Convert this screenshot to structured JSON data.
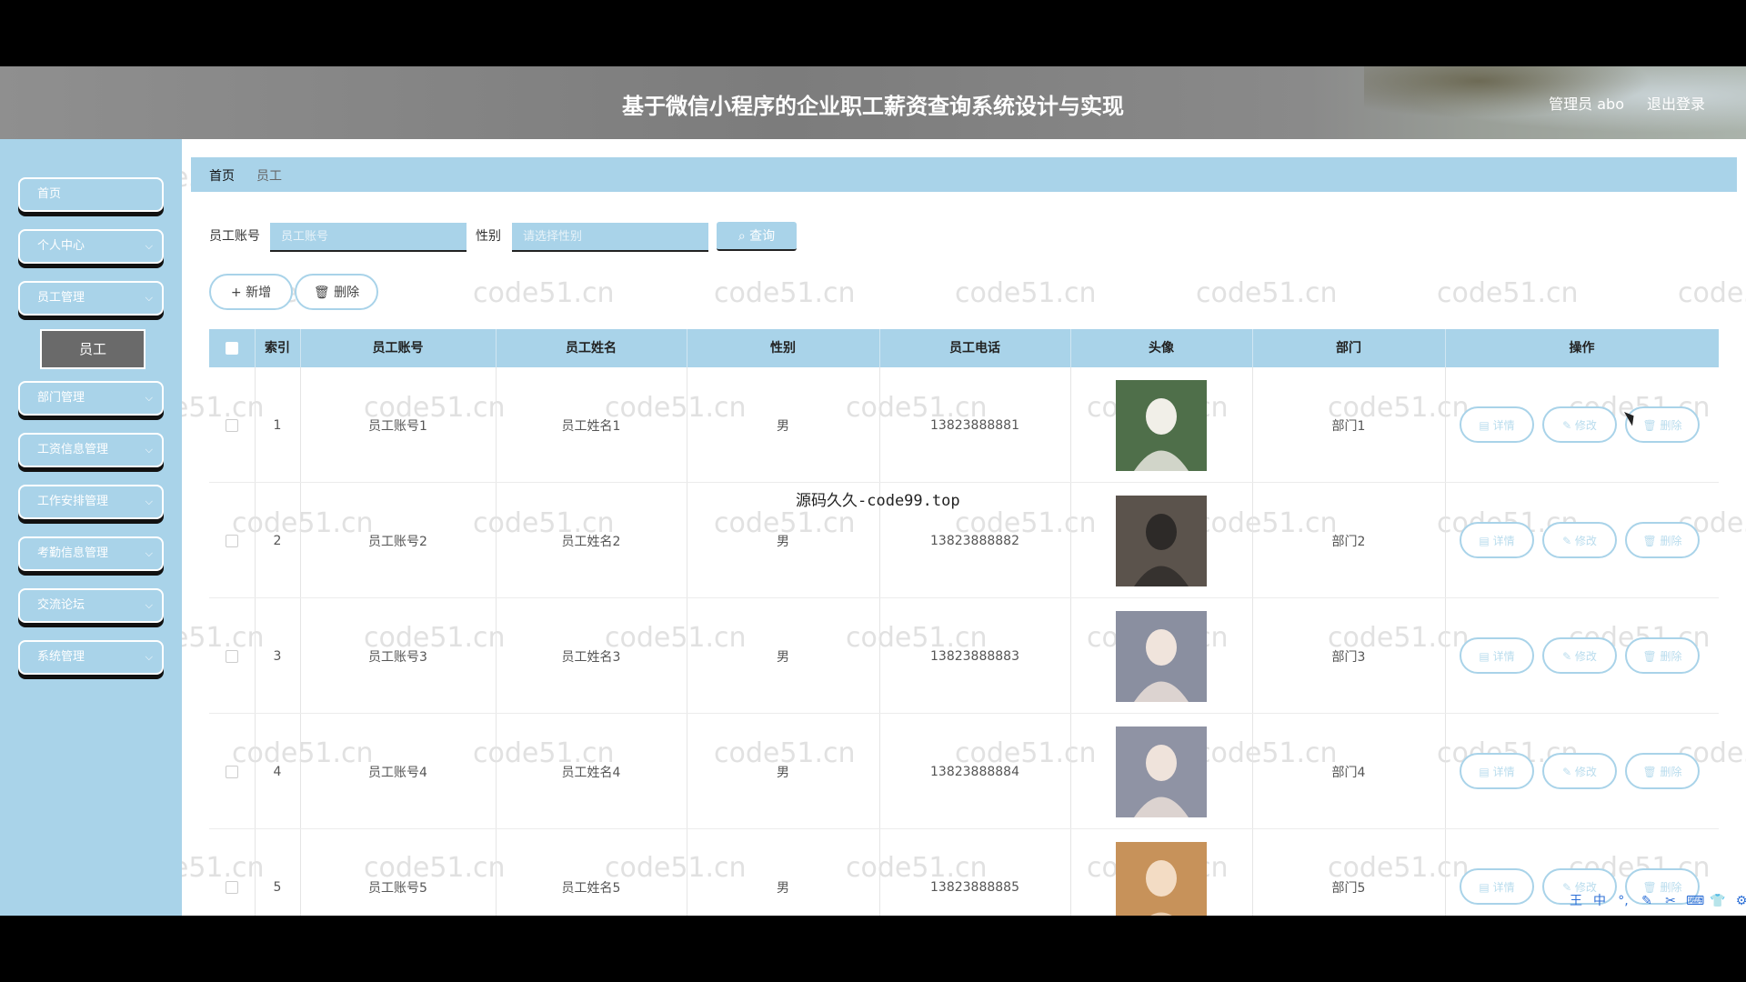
{
  "header": {
    "title": "基于微信小程序的企业职工薪资查询系统设计与实现",
    "admin": "管理员 abo",
    "logout": "退出登录"
  },
  "sidebar": {
    "items": [
      {
        "label": "首页",
        "chevron": false
      },
      {
        "label": "个人中心",
        "chevron": true
      },
      {
        "label": "员工管理",
        "chevron": true,
        "sub": "员工"
      },
      {
        "label": "部门管理",
        "chevron": true
      },
      {
        "label": "工资信息管理",
        "chevron": true
      },
      {
        "label": "工作安排管理",
        "chevron": true
      },
      {
        "label": "考勤信息管理",
        "chevron": true
      },
      {
        "label": "交流论坛",
        "chevron": true
      },
      {
        "label": "系统管理",
        "chevron": true
      }
    ],
    "chevron_icon": "⌵"
  },
  "breadcrumb": {
    "home": "首页",
    "current": "员工"
  },
  "search": {
    "account_label": "员工账号",
    "account_placeholder": "员工账号",
    "gender_label": "性别",
    "gender_placeholder": "请选择性别",
    "button": "⌕ 查询"
  },
  "actions": {
    "add": "+ 新增",
    "delete": "🗑 删除"
  },
  "table": {
    "headers": [
      "",
      "索引",
      "员工账号",
      "员工姓名",
      "性别",
      "员工电话",
      "头像",
      "部门",
      "操作"
    ],
    "row_buttons": {
      "detail": "▤ 详情",
      "edit": "✎ 修改",
      "delete": "🗑 删除"
    },
    "rows": [
      {
        "index": "1",
        "account": "员工账号1",
        "name": "员工姓名1",
        "gender": "男",
        "phone": "13823888881",
        "dept": "部门1",
        "avatar_bg": "#4f6f4a",
        "avatar_fg": "#f1efe8"
      },
      {
        "index": "2",
        "account": "员工账号2",
        "name": "员工姓名2",
        "gender": "男",
        "phone": "13823888882",
        "dept": "部门2",
        "avatar_bg": "#5b534c",
        "avatar_fg": "#2d2a28"
      },
      {
        "index": "3",
        "account": "员工账号3",
        "name": "员工姓名3",
        "gender": "男",
        "phone": "13823888883",
        "dept": "部门3",
        "avatar_bg": "#8a8fa0",
        "avatar_fg": "#f0e4dc"
      },
      {
        "index": "4",
        "account": "员工账号4",
        "name": "员工姓名4",
        "gender": "男",
        "phone": "13823888884",
        "dept": "部门4",
        "avatar_bg": "#8f93a4",
        "avatar_fg": "#efe3db"
      },
      {
        "index": "5",
        "account": "员工账号5",
        "name": "员工姓名5",
        "gender": "男",
        "phone": "13823888885",
        "dept": "部门5",
        "avatar_bg": "#c7925a",
        "avatar_fg": "#f3dcc4"
      }
    ]
  },
  "watermark_text": "code51.cn",
  "overlay_watermark": "源码久久-code99.top",
  "ime_icons": [
    "王",
    "中",
    "°,",
    "✎",
    "✂",
    "⌨",
    "👕",
    "⚙"
  ],
  "colors": {
    "accent": "#a9d3e9",
    "header": "#8a8a8a",
    "nav_active": "#6a6a6a"
  }
}
